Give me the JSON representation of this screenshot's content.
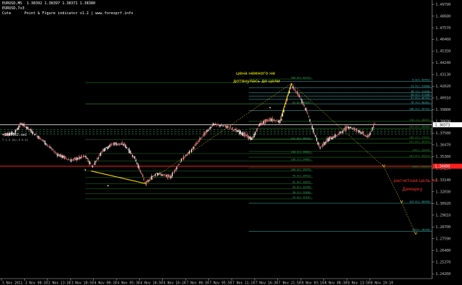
{
  "header": {
    "symbol_line": "EURUSD,M5  1.38392 1.38397 1.38371 1.38380",
    "indicator_line": "EURUSD,7x3",
    "info_line": "Cute      Point & Figure indicator v1.2 | www.forexprf.info"
  },
  "price_axis": {
    "labels": [
      {
        "price": 1.4979,
        "text": "1.49790"
      },
      {
        "price": 1.4868,
        "text": "1.48680"
      },
      {
        "price": 1.4757,
        "text": "1.47570"
      },
      {
        "price": 1.4646,
        "text": "1.46460"
      },
      {
        "price": 1.4535,
        "text": "1.45350"
      },
      {
        "price": 1.4424,
        "text": "1.44240"
      },
      {
        "price": 1.4313,
        "text": "1.43130"
      },
      {
        "price": 1.4202,
        "text": "1.42020"
      },
      {
        "price": 1.4091,
        "text": "1.40910"
      },
      {
        "price": 1.398,
        "text": "1.39800"
      },
      {
        "price": 1.3869,
        "text": "1.38690"
      },
      {
        "price": 1.3758,
        "text": "1.37580"
      },
      {
        "price": 1.3647,
        "text": "1.36470"
      },
      {
        "price": 1.3536,
        "text": "1.35360"
      },
      {
        "price": 1.3425,
        "text": "1.34250"
      },
      {
        "price": 1.3314,
        "text": "1.33140"
      },
      {
        "price": 1.3203,
        "text": "1.32030"
      },
      {
        "price": 1.3092,
        "text": "1.30920"
      },
      {
        "price": 1.2981,
        "text": "1.29810"
      },
      {
        "price": 1.287,
        "text": "1.28700"
      },
      {
        "price": 1.2759,
        "text": "1.27590"
      },
      {
        "price": 1.2648,
        "text": "1.26480"
      },
      {
        "price": 1.2537,
        "text": "1.25370"
      },
      {
        "price": 1.2426,
        "text": "1.24260"
      }
    ],
    "current_price": {
      "price": 1.3838,
      "text": "1.38373"
    },
    "red_line_price": {
      "price": 1.3445,
      "text": "1.34490"
    },
    "range": [
      1.238,
      1.502
    ]
  },
  "time_axis": {
    "labels": [
      "3 Nov 2011",
      "3 Nov 08:10",
      "3 Nov 13:30",
      "3 Nov 18:50",
      "4 Nov 00:10",
      "4 Nov 05:30",
      "4 Nov 10:50",
      "4 Nov 16:10",
      "7 Nov 00:30",
      "7 Nov 05:50",
      "7 Nov 11:10",
      "7 Nov 16:30",
      "7 Nov 21:50",
      "8 Nov 03:10",
      "8 Nov 08:30",
      "8 Nov 13:50",
      "8 Nov 19:10"
    ]
  },
  "left_label": {
    "text": "=1688602.swi",
    "sub": "T 1.3 2x(-3.5-3)"
  },
  "fib_levels": [
    {
      "text": "0.0(1.42442)",
      "price": 1.425
    },
    {
      "text": "23.6(1.41808)",
      "price": 1.4188
    },
    {
      "text": "38.2(1.41408)",
      "price": 1.414
    },
    {
      "text": "50.0(1.41108)",
      "price": 1.411
    },
    {
      "text": "61.8(1.40785)",
      "price": 1.4078
    },
    {
      "text": "76.4(1.40361)",
      "price": 1.4036
    },
    {
      "text": "100.0(1.39731)",
      "price": 1.3973
    },
    {
      "text": "138.2(1.38697)",
      "price": 1.387
    },
    {
      "text": "161.8(1.38066)",
      "price": 1.3806
    },
    {
      "text": "200.0(1.37031)",
      "price": 1.3704
    },
    {
      "text": "261.8(1.36953)",
      "price": 1.3664
    },
    {
      "text": "240(1.35846)",
      "price": 1.3585
    },
    {
      "text": "261.8(1.35315)",
      "price": 1.3531
    },
    {
      "text": "300(1.34297)",
      "price": 1.343
    },
    {
      "text": "423.6(1.30939)",
      "price": 1.3094
    },
    {
      "text": "525(1.28290)",
      "price": 1.2829
    }
  ],
  "mid_fib_levels": [
    {
      "text": "100.0(1.42721)",
      "price": 1.4272
    },
    {
      "text": "61.8(1.40355)",
      "price": 1.4036
    },
    {
      "text": "111.8(1.36945)",
      "price": 1.3695
    },
    {
      "text": "138.2(1.35651)",
      "price": 1.3565
    },
    {
      "text": "138.2(1.34962)",
      "price": 1.3496
    },
    {
      "text": "100.0(1.33979)",
      "price": 1.3398
    },
    {
      "text": "76.4(1.33412)",
      "price": 1.3341
    },
    {
      "text": "61.8(1.32815)",
      "price": 1.3281
    },
    {
      "text": "50.0(1.32338)",
      "price": 1.3234
    },
    {
      "text": "38.2(1.31830)",
      "price": 1.3183
    },
    {
      "text": "23.6(1.31347)",
      "price": 1.3135
    }
  ],
  "annotations": {
    "top_note_line1": "цена немного не",
    "top_note_line2": "дотянулась до цели",
    "right_note_line1": "расчетная цель по",
    "right_note_line2": "Демарку"
  },
  "colors": {
    "candles": "#f08080",
    "fib_green": "#2e8b2e",
    "fib_cyan": "#40c0c0",
    "yellow": "#ffd700",
    "red": "#ff2020",
    "text_yellow": "#ffff00",
    "text_red": "#ff3030"
  }
}
